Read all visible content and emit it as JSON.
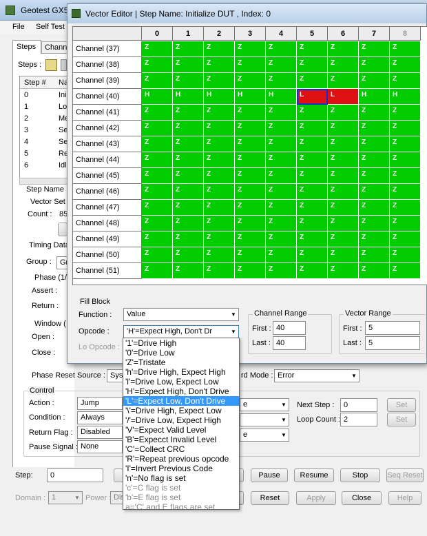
{
  "main_window": {
    "title": "Geotest GX5",
    "menu": [
      "File",
      "Self Test"
    ],
    "tabs": [
      "Steps",
      "Chann"
    ],
    "steps_label": "Steps :",
    "steps_table": {
      "headers": [
        "Step #",
        "Na"
      ],
      "rows": [
        {
          "num": "0",
          "name": "Ini"
        },
        {
          "num": "1",
          "name": "Lo"
        },
        {
          "num": "2",
          "name": "Me"
        },
        {
          "num": "3",
          "name": "Se"
        },
        {
          "num": "4",
          "name": "Se"
        },
        {
          "num": "5",
          "name": "Re"
        },
        {
          "num": "6",
          "name": "Idl"
        }
      ]
    },
    "step_name_label": "Step Name",
    "vector_set_label": "Vector Set",
    "count_label": "Count :",
    "count_value": "85",
    "timing_label": "Timing Data",
    "group_label": "Group :",
    "group_value": "Gr",
    "phase_label": "Phase (1/",
    "assert_label": "Assert :",
    "return_label": "Return :",
    "window_label": "Window (",
    "open_label": "Open :",
    "close_label": "Close :",
    "phase_reset_label": "Phase Reset Source :",
    "phase_reset_value": "Syst",
    "rd_mode_label": "rd Mode :",
    "rd_mode_value": "Error",
    "control_label": "Control",
    "action_label": "Action :",
    "action_value": "Jump",
    "condition_label": "Condition :",
    "condition_value": "Always",
    "return_flag_label": "Return Flag :",
    "return_flag_value": "Disabled",
    "pause_signal_label": "Pause Signal :",
    "pause_signal_value": "None",
    "extra_combo_1": "e",
    "extra_combo_2": "e",
    "next_step_label": "Next Step :",
    "next_step_value": "0",
    "loop_count_label": "Loop Count :",
    "loop_count_value": "2",
    "set_label": "Set",
    "step_label": "Step:",
    "step_value": "0",
    "pause_btn": "Pause",
    "resume_btn": "Resume",
    "stop_btn": "Stop",
    "seq_reset_btn": "Seq Reset",
    "domain_label": "Domain :",
    "domain_value": "1",
    "power_label": "Power :",
    "power_value": "Dis",
    "reset_btn": "Reset",
    "apply_btn": "Apply",
    "close_btn": "Close",
    "help_btn": "Help"
  },
  "vector_editor": {
    "title": "Vector Editor |  Step Name: Initialize DUT  ,  Index: 0",
    "columns": [
      "0",
      "1",
      "2",
      "3",
      "4",
      "5",
      "6",
      "7",
      "8"
    ],
    "rows": [
      {
        "label": "Channel (37)",
        "cells": [
          "Z",
          "Z",
          "Z",
          "Z",
          "Z",
          "Z",
          "Z",
          "Z",
          "Z"
        ]
      },
      {
        "label": "Channel (38)",
        "cells": [
          "Z",
          "Z",
          "Z",
          "Z",
          "Z",
          "Z",
          "Z",
          "Z",
          "Z"
        ]
      },
      {
        "label": "Channel (39)",
        "cells": [
          "Z",
          "Z",
          "Z",
          "Z",
          "Z",
          "Z",
          "Z",
          "Z",
          "Z"
        ]
      },
      {
        "label": "Channel (40)",
        "cells": [
          "H",
          "H",
          "H",
          "H",
          "H",
          "L",
          "L",
          "H",
          "H"
        ]
      },
      {
        "label": "Channel (41)",
        "cells": [
          "Z",
          "Z",
          "Z",
          "Z",
          "Z",
          "Z",
          "Z",
          "Z",
          "Z"
        ]
      },
      {
        "label": "Channel (42)",
        "cells": [
          "Z",
          "Z",
          "Z",
          "Z",
          "Z",
          "Z",
          "Z",
          "Z",
          "Z"
        ]
      },
      {
        "label": "Channel (43)",
        "cells": [
          "Z",
          "Z",
          "Z",
          "Z",
          "Z",
          "Z",
          "Z",
          "Z",
          "Z"
        ]
      },
      {
        "label": "Channel (44)",
        "cells": [
          "Z",
          "Z",
          "Z",
          "Z",
          "Z",
          "Z",
          "Z",
          "Z",
          "Z"
        ]
      },
      {
        "label": "Channel (45)",
        "cells": [
          "Z",
          "Z",
          "Z",
          "Z",
          "Z",
          "Z",
          "Z",
          "Z",
          "Z"
        ]
      },
      {
        "label": "Channel (46)",
        "cells": [
          "Z",
          "Z",
          "Z",
          "Z",
          "Z",
          "Z",
          "Z",
          "Z",
          "Z"
        ]
      },
      {
        "label": "Channel (47)",
        "cells": [
          "Z",
          "Z",
          "Z",
          "Z",
          "Z",
          "Z",
          "Z",
          "Z",
          "Z"
        ]
      },
      {
        "label": "Channel (48)",
        "cells": [
          "Z",
          "Z",
          "Z",
          "Z",
          "Z",
          "Z",
          "Z",
          "Z",
          "Z"
        ]
      },
      {
        "label": "Channel (49)",
        "cells": [
          "Z",
          "Z",
          "Z",
          "Z",
          "Z",
          "Z",
          "Z",
          "Z",
          "Z"
        ]
      },
      {
        "label": "Channel (50)",
        "cells": [
          "Z",
          "Z",
          "Z",
          "Z",
          "Z",
          "Z",
          "Z",
          "Z",
          "Z"
        ]
      },
      {
        "label": "Channel (51)",
        "cells": [
          "Z",
          "Z",
          "Z",
          "Z",
          "Z",
          "Z",
          "Z",
          "Z",
          "Z"
        ]
      }
    ],
    "fill_block_label": "Fill Block",
    "function_label": "Function :",
    "function_value": "Value",
    "opcode_label": "Opcode :",
    "opcode_value": "'H'=Expect High, Don't Dr",
    "lo_opcode_label": "Lo Opcode :",
    "channel_range_label": "Channel Range",
    "channel_first_label": "First :",
    "channel_first_value": "40",
    "channel_last_label": "Last :",
    "channel_last_value": "40",
    "vector_range_label": "Vector Range",
    "vector_first_label": "First :",
    "vector_first_value": "5",
    "vector_last_label": "Last :",
    "vector_last_value": "5"
  },
  "opcode_options": [
    "'1'=Drive High",
    "'0'=Drive Low",
    "'Z'=Tristate",
    "'h'=Drive High, Expect High",
    "'l'=Drive Low, Expect Low",
    "'H'=Expect High, Don't Drive",
    "'L'=Expect Low, Don't Drive",
    "'\\'=Drive High, Expect Low",
    "'/'=Drive Low, Expect High",
    "'V'=Expect Valid Level",
    "'B'=Expecct Invalid Level",
    "'C'=Collect CRC",
    "'R'=Repeat previous opcode",
    "'I'=Invert Previous Code",
    "'n'=No flag is set",
    "'c'=C flag is set",
    "'b'=E flag is set",
    "a='C' and E flags are set"
  ],
  "highlighted_option_index": 6,
  "colors": {
    "cell_green": "#00cc00",
    "cell_red": "#dd1111",
    "highlight": "#3399ff"
  }
}
